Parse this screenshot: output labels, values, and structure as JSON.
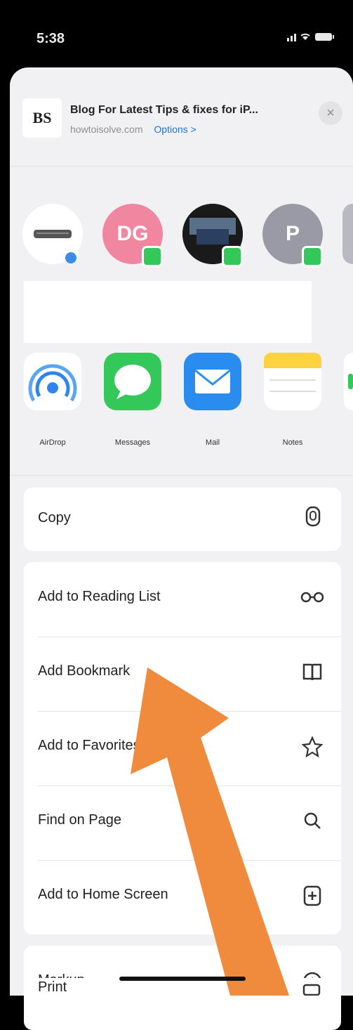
{
  "status_bar": {
    "time": "5:38",
    "icons": "signal wifi battery"
  },
  "share_header": {
    "thumb_text": "BS",
    "title": "Blog For Latest Tips & fixes for iP...",
    "url": "howtoisolve.com",
    "options_label": "Options >",
    "close_label": "×"
  },
  "contacts": [
    {
      "initials": "",
      "color": "#ffffff"
    },
    {
      "initials": "DG",
      "color": "#f0869f"
    },
    {
      "initials": "",
      "color": "#111111"
    },
    {
      "initials": "P",
      "color": "#9a9aa6"
    },
    {
      "initials": "",
      "color": "#b9b9c2"
    }
  ],
  "apps": [
    {
      "label": "AirDrop"
    },
    {
      "label": "Messages"
    },
    {
      "label": "Mail"
    },
    {
      "label": "Notes"
    }
  ],
  "actions_group1": [
    {
      "label": "Copy",
      "icon": "copy-icon"
    }
  ],
  "actions_group2": [
    {
      "label": "Add to Reading List",
      "icon": "glasses-icon"
    },
    {
      "label": "Add Bookmark",
      "icon": "book-icon"
    },
    {
      "label": "Add to Favorites",
      "icon": "star-icon"
    },
    {
      "label": "Find on Page",
      "icon": "search-icon"
    },
    {
      "label": "Add to Home Screen",
      "icon": "add-square-icon"
    }
  ],
  "actions_group3": [
    {
      "label": "Markup",
      "icon": "markup-icon"
    },
    {
      "label": "Print",
      "icon": "printer-icon"
    }
  ],
  "colors": {
    "accent": "#1a73e8",
    "arrow": "#f08a3c",
    "sheet": "#f1f1f3"
  }
}
